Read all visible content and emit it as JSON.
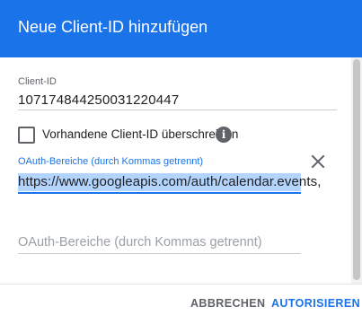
{
  "header": {
    "title": "Neue Client-ID hinzufügen"
  },
  "client_id": {
    "label": "Client-ID",
    "value": "107174844250031220447"
  },
  "overwrite": {
    "label": "Vorhandene Client-ID überschreiben",
    "checked": false,
    "info_icon": "info-icon",
    "info_glyph": "i"
  },
  "scopes": {
    "label": "OAuth-Bereiche (durch Kommas getrennt)",
    "value": "https://www.googleapis.com/auth/calendar.events,",
    "clear_icon": "close-icon",
    "empty_placeholder": "OAuth-Bereiche (durch Kommas getrennt)"
  },
  "footer": {
    "cancel_label": "ABBRECHEN",
    "authorize_label": "AUTORISIEREN"
  },
  "colors": {
    "accent": "#1a73e8",
    "selection": "#b3d4fc",
    "muted_text": "#5f6368"
  }
}
